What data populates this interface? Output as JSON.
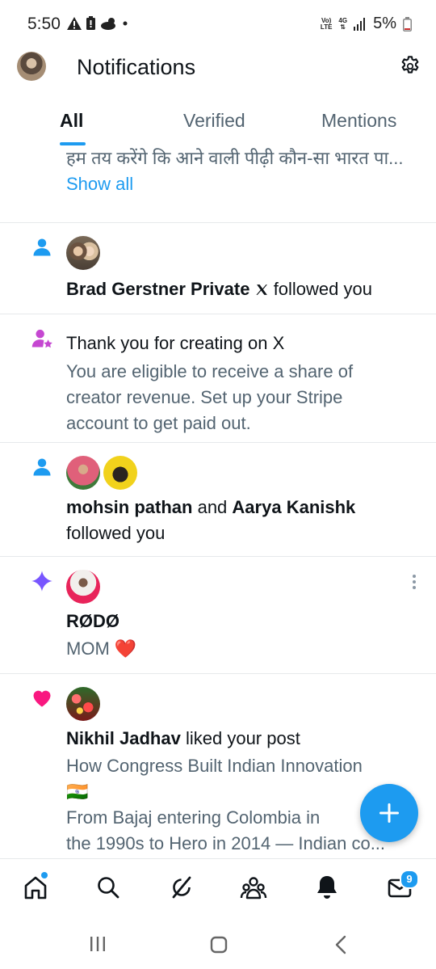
{
  "status_bar": {
    "time": "5:50",
    "network_top": "Vo)",
    "network_bottom": "LTE",
    "signal_label": "4G",
    "battery": "5%"
  },
  "header": {
    "title": "Notifications"
  },
  "tabs": [
    {
      "label": "All"
    },
    {
      "label": "Verified"
    },
    {
      "label": "Mentions"
    }
  ],
  "feed": {
    "item0": {
      "partial_line": "हम तय करेंगे कि आने वाली पीढ़ी कौन-सा भारत पा...",
      "show_all": "Show all"
    },
    "item1": {
      "name": "Brad Gerstner Private",
      "action": "followed you"
    },
    "item2": {
      "title": "Thank you for creating on X",
      "body1": "You are eligible to receive a share of",
      "body2": "creator revenue. Set up your Stripe",
      "body3": "account to get paid out."
    },
    "item3": {
      "name1": "mohsin pathan",
      "and": "and",
      "name2": "Aarya Kanishk",
      "action": "followed you"
    },
    "item4": {
      "name": "RØDØ",
      "text": "MOM",
      "emoji": "❤️"
    },
    "item5": {
      "name": "Nikhil Jadhav",
      "action": "liked your post",
      "line1": "How Congress Built Indian Innovation",
      "flag": "🇮🇳",
      "line2": "From Bajaj entering Colombia in",
      "line3": "the 1990s to Hero in 2014 — Indian co..."
    }
  },
  "bottom_nav": {
    "messages_badge": "9"
  },
  "colors": {
    "accent": "#1d9bf0",
    "text": "#0f1419",
    "muted": "#536471",
    "like": "#f91880",
    "sparkle": "#7856ff",
    "creator": "#c547d1"
  }
}
